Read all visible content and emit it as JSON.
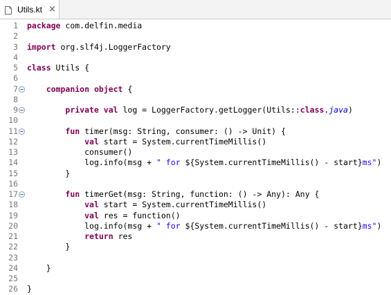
{
  "tab": {
    "label": "Utils.kt",
    "close_glyph": "×"
  },
  "lines": [
    {
      "n": "1",
      "fold": false,
      "indent": 0,
      "t": [
        [
          "kw",
          "package"
        ],
        [
          "",
          "com.delfin.media"
        ]
      ]
    },
    {
      "n": "2",
      "fold": false,
      "indent": 0,
      "t": []
    },
    {
      "n": "3",
      "fold": false,
      "indent": 0,
      "t": [
        [
          "kw",
          "import"
        ],
        [
          "",
          "org.slf4j.LoggerFactory"
        ]
      ]
    },
    {
      "n": "4",
      "fold": false,
      "indent": 0,
      "t": []
    },
    {
      "n": "5",
      "fold": false,
      "indent": 0,
      "t": [
        [
          "kw",
          "class"
        ],
        [
          "",
          " Utils {"
        ]
      ]
    },
    {
      "n": "6",
      "fold": false,
      "indent": 0,
      "t": []
    },
    {
      "n": "7",
      "fold": true,
      "indent": 1,
      "t": [
        [
          "kw",
          "companion object"
        ],
        [
          "",
          " {"
        ]
      ]
    },
    {
      "n": "8",
      "fold": false,
      "indent": 0,
      "t": []
    },
    {
      "n": "9",
      "fold": true,
      "indent": 2,
      "t": [
        [
          "kw",
          "private val"
        ],
        [
          "",
          " log = LoggerFactory.getLogger(Utils::"
        ],
        [
          "kw",
          "class"
        ],
        [
          "",
          "."
        ],
        [
          "it",
          "java"
        ],
        [
          "",
          ")"
        ]
      ]
    },
    {
      "n": "10",
      "fold": false,
      "indent": 0,
      "t": []
    },
    {
      "n": "11",
      "fold": true,
      "indent": 2,
      "t": [
        [
          "kw",
          "fun"
        ],
        [
          "",
          " timer(msg: String, consumer: () -> Unit) {"
        ]
      ]
    },
    {
      "n": "12",
      "fold": false,
      "indent": 3,
      "t": [
        [
          "kw",
          "val"
        ],
        [
          "",
          " start = System.currentTimeMillis()"
        ]
      ]
    },
    {
      "n": "13",
      "fold": false,
      "indent": 3,
      "t": [
        [
          "",
          "consumer()"
        ]
      ]
    },
    {
      "n": "14",
      "fold": false,
      "indent": 3,
      "t": [
        [
          "",
          "log.info(msg + "
        ],
        [
          "str",
          "\" for "
        ],
        [
          "",
          "${System.currentTimeMillis() - start}"
        ],
        [
          "str",
          "ms\""
        ],
        [
          "",
          ")"
        ]
      ]
    },
    {
      "n": "15",
      "fold": false,
      "indent": 2,
      "t": [
        [
          "",
          "}"
        ]
      ]
    },
    {
      "n": "16",
      "fold": false,
      "indent": 0,
      "t": []
    },
    {
      "n": "17",
      "fold": true,
      "indent": 2,
      "t": [
        [
          "kw",
          "fun"
        ],
        [
          "",
          " timerGet(msg: String, function: () -> Any): Any {"
        ]
      ]
    },
    {
      "n": "18",
      "fold": false,
      "indent": 3,
      "t": [
        [
          "kw",
          "val"
        ],
        [
          "",
          " start = System.currentTimeMillis()"
        ]
      ]
    },
    {
      "n": "19",
      "fold": false,
      "indent": 3,
      "t": [
        [
          "kw",
          "val"
        ],
        [
          "",
          " res = function()"
        ]
      ]
    },
    {
      "n": "20",
      "fold": false,
      "indent": 3,
      "t": [
        [
          "",
          "log.info(msg + "
        ],
        [
          "str",
          "\" for "
        ],
        [
          "",
          "${System.currentTimeMillis() - start}"
        ],
        [
          "str",
          "ms\""
        ],
        [
          "",
          ")"
        ]
      ]
    },
    {
      "n": "21",
      "fold": false,
      "indent": 3,
      "t": [
        [
          "kw",
          "return"
        ],
        [
          "",
          " res"
        ]
      ]
    },
    {
      "n": "22",
      "fold": false,
      "indent": 2,
      "t": [
        [
          "",
          "}"
        ]
      ]
    },
    {
      "n": "23",
      "fold": false,
      "indent": 0,
      "t": []
    },
    {
      "n": "24",
      "fold": false,
      "indent": 1,
      "t": [
        [
          "",
          "}"
        ]
      ]
    },
    {
      "n": "25",
      "fold": false,
      "indent": 0,
      "t": []
    },
    {
      "n": "26",
      "fold": false,
      "indent": 0,
      "t": [
        [
          "",
          "}"
        ]
      ]
    }
  ]
}
